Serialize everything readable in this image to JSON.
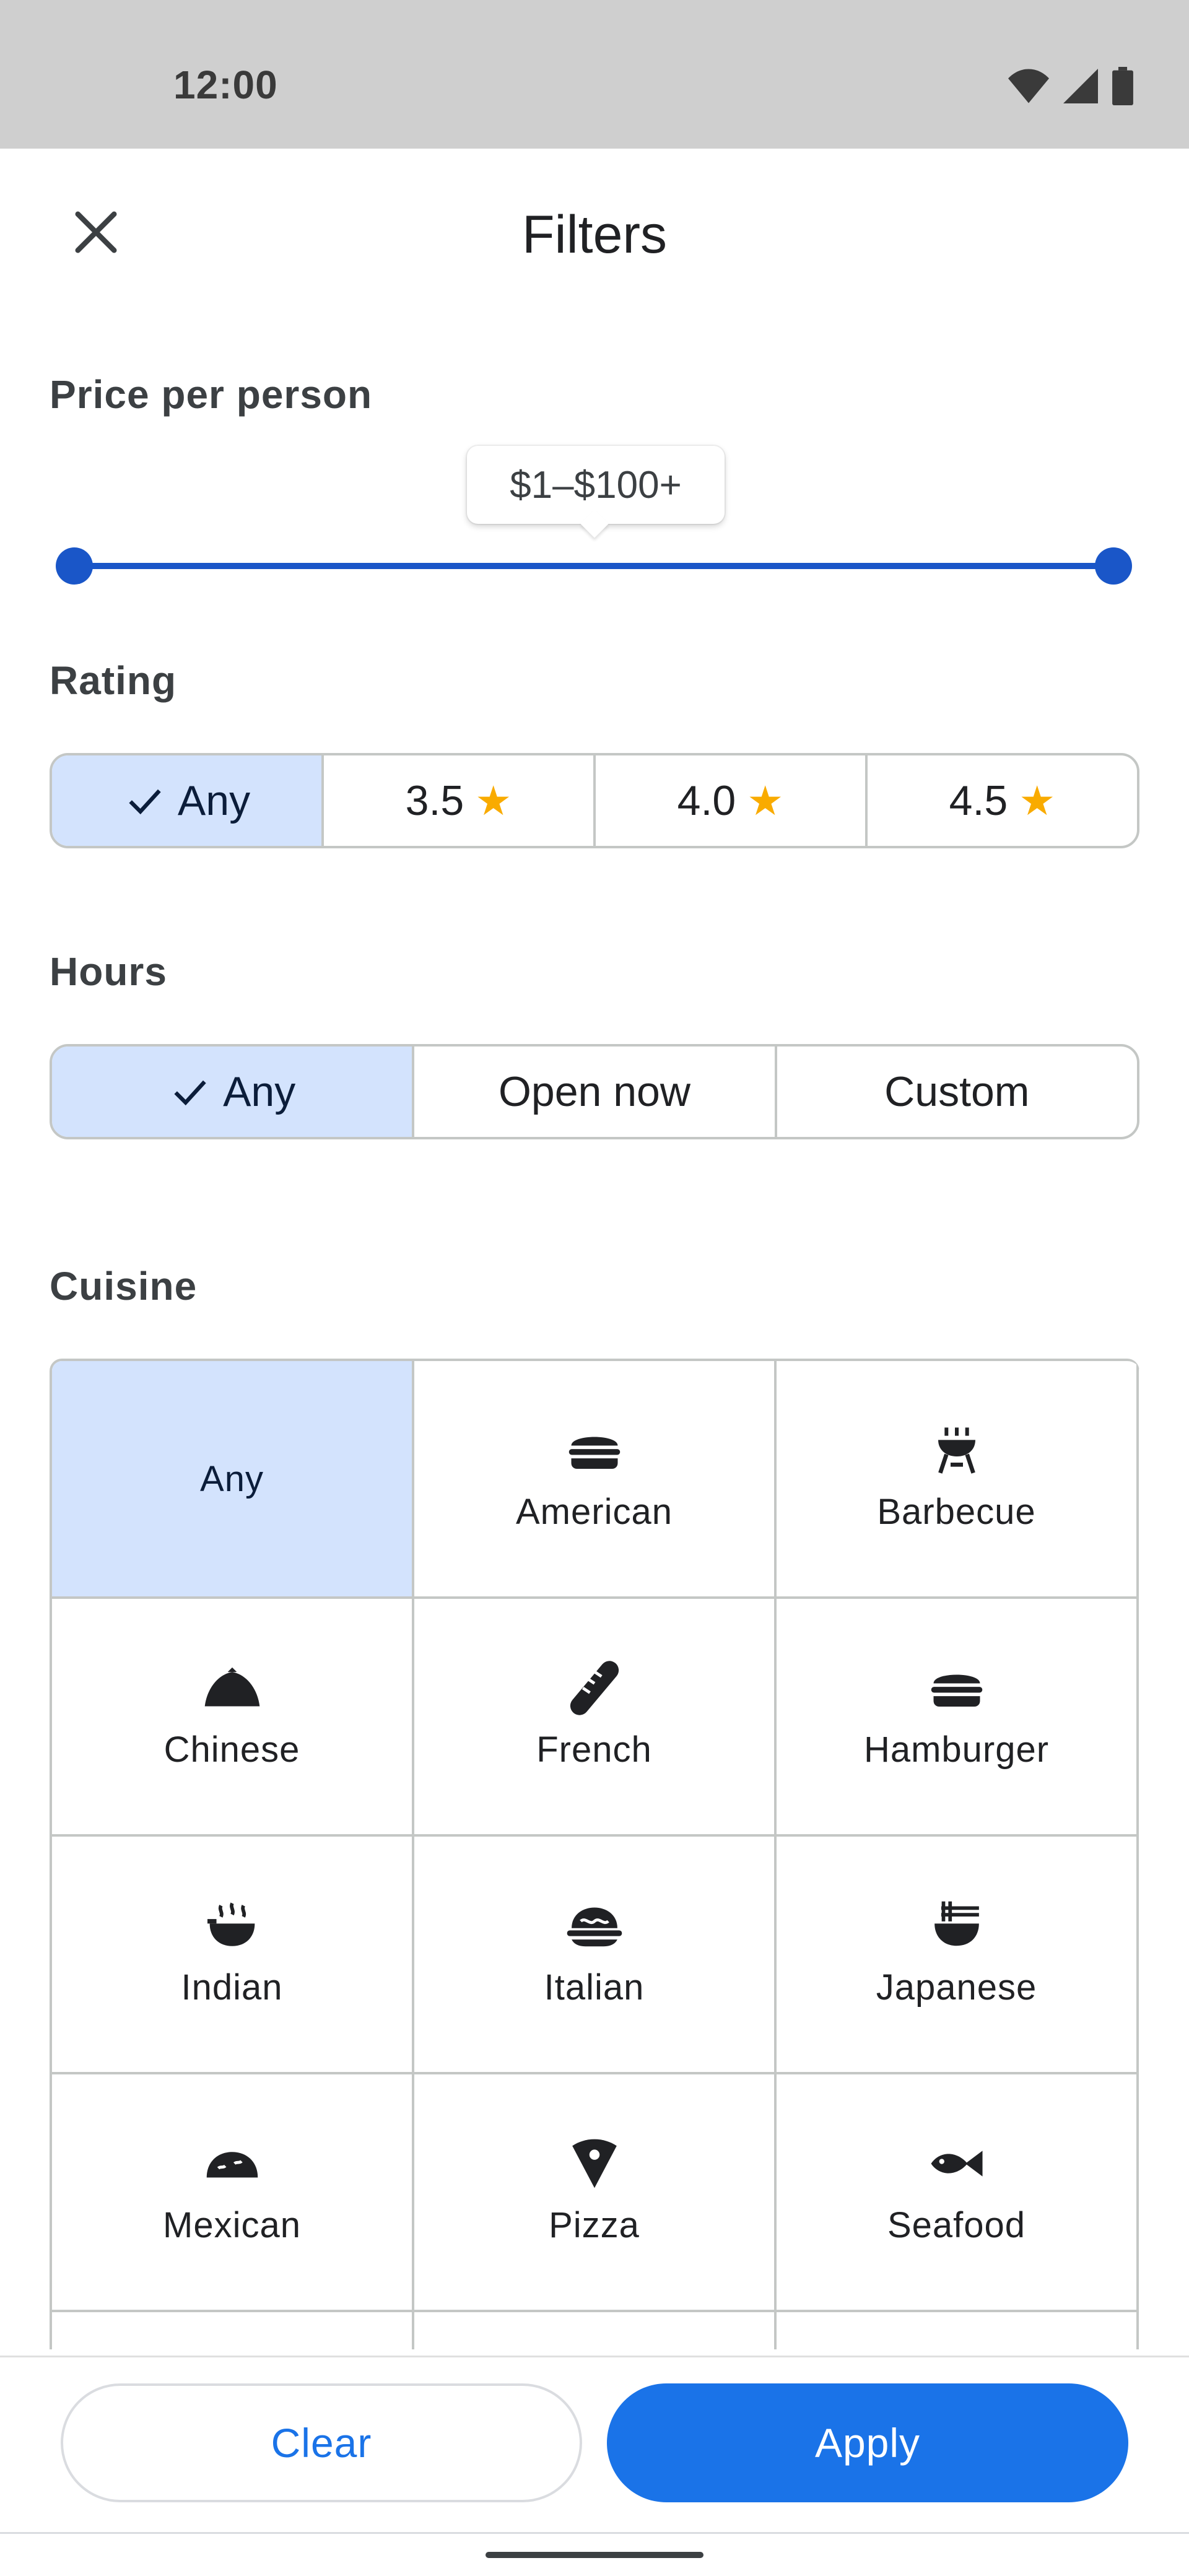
{
  "status_bar": {
    "time": "12:00"
  },
  "header": {
    "title": "Filters"
  },
  "price": {
    "label": "Price per person",
    "range_text": "$1–$100+",
    "min_level": 0,
    "max_level": 1
  },
  "rating": {
    "label": "Rating",
    "options": [
      {
        "label": "Any",
        "selected": true
      },
      {
        "label": "3.5",
        "star": true
      },
      {
        "label": "4.0",
        "star": true
      },
      {
        "label": "4.5",
        "star": true
      }
    ]
  },
  "hours": {
    "label": "Hours",
    "options": [
      {
        "label": "Any",
        "selected": true
      },
      {
        "label": "Open now"
      },
      {
        "label": "Custom"
      }
    ]
  },
  "cuisine": {
    "label": "Cuisine",
    "items": [
      {
        "label": "Any",
        "icon": "none",
        "selected": true
      },
      {
        "label": "American",
        "icon": "burger-icon"
      },
      {
        "label": "Barbecue",
        "icon": "grill-icon"
      },
      {
        "label": "Chinese",
        "icon": "dumpling-icon"
      },
      {
        "label": "French",
        "icon": "baguette-icon"
      },
      {
        "label": "Hamburger",
        "icon": "burger-icon"
      },
      {
        "label": "Indian",
        "icon": "curry-bowl-icon"
      },
      {
        "label": "Italian",
        "icon": "pasta-icon"
      },
      {
        "label": "Japanese",
        "icon": "ramen-icon"
      },
      {
        "label": "Mexican",
        "icon": "taco-icon"
      },
      {
        "label": "Pizza",
        "icon": "pizza-icon"
      },
      {
        "label": "Seafood",
        "icon": "fish-icon"
      }
    ]
  },
  "actions": {
    "clear_label": "Clear",
    "apply_label": "Apply"
  },
  "colors": {
    "accent": "#1a73e8",
    "selected_bg": "#d3e3fd",
    "slider": "#1a56c8",
    "star": "#f9ab00"
  }
}
